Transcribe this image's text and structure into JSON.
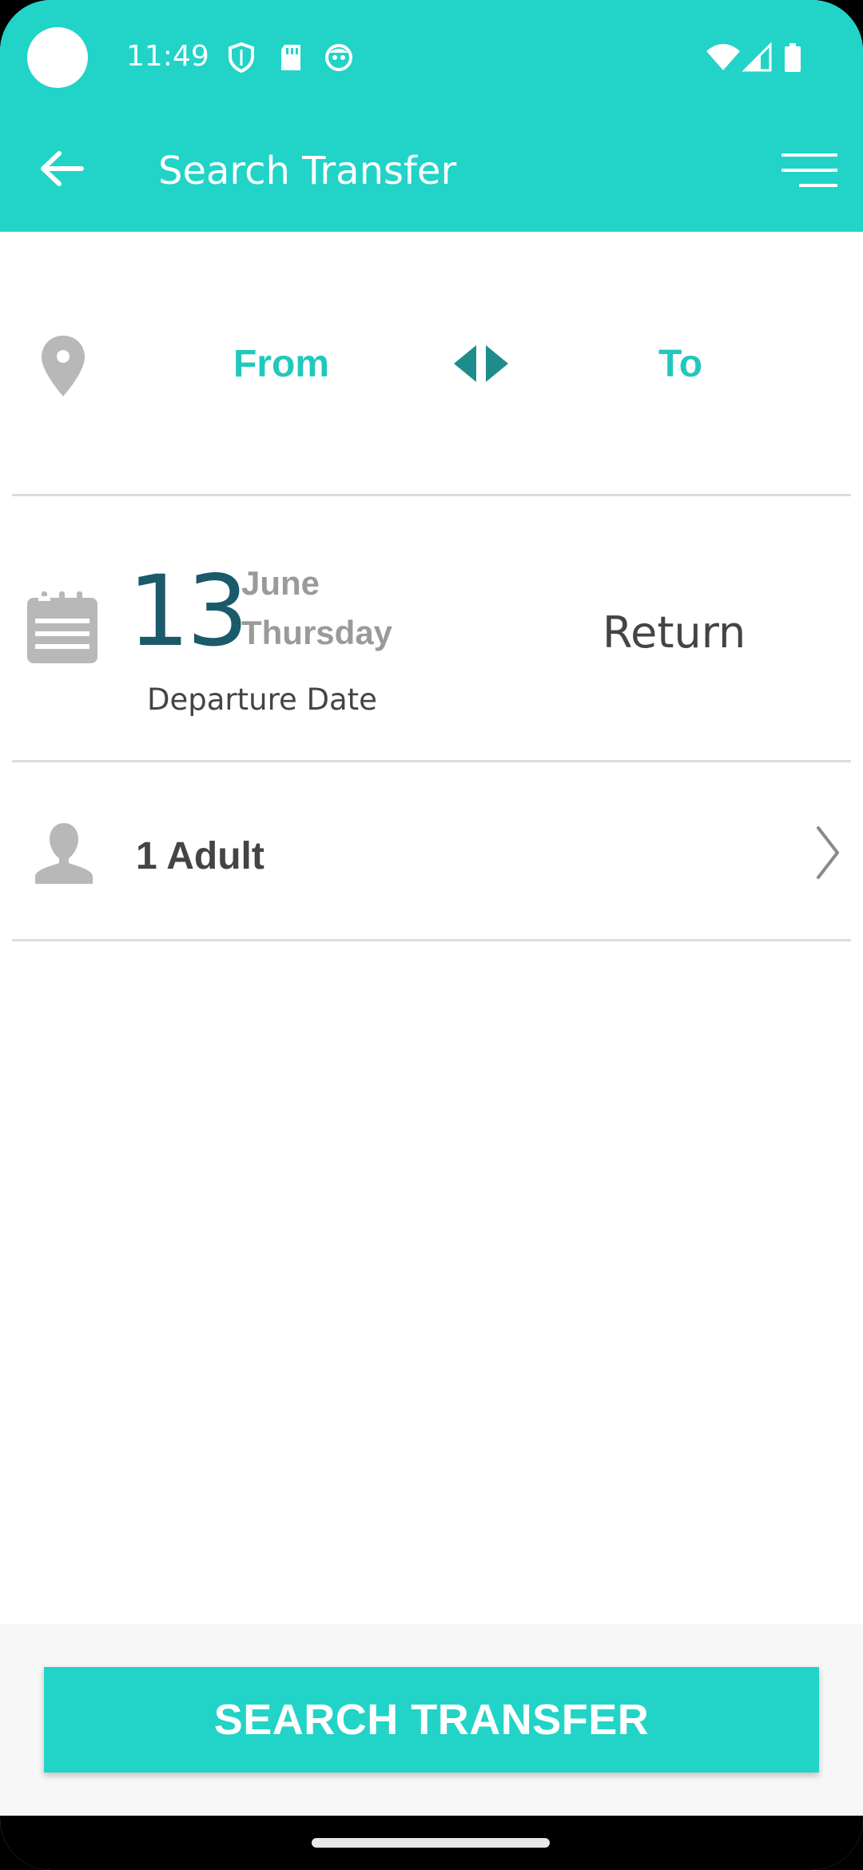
{
  "status_bar": {
    "time": "11:49"
  },
  "app_bar": {
    "title": "Search Transfer",
    "back_icon": "arrow-left-icon",
    "menu_icon": "hamburger-menu-icon"
  },
  "route": {
    "from_label": "From",
    "to_label": "To",
    "location_icon": "map-pin-icon",
    "swap_icon": "swap-arrows-icon"
  },
  "dates": {
    "day": "13",
    "month": "June",
    "weekday": "Thursday",
    "departure_label": "Departure Date",
    "return_label": "Return",
    "calendar_icon": "calendar-icon"
  },
  "passengers": {
    "label": "1 Adult",
    "person_icon": "person-icon",
    "chevron_icon": "chevron-right-icon"
  },
  "actions": {
    "search_label": "SEARCH TRANSFER"
  },
  "colors": {
    "primary": "#22d3c7",
    "accent_text": "#22c8bd",
    "day_number": "#1a5a6b",
    "muted": "#9a9a9a"
  }
}
